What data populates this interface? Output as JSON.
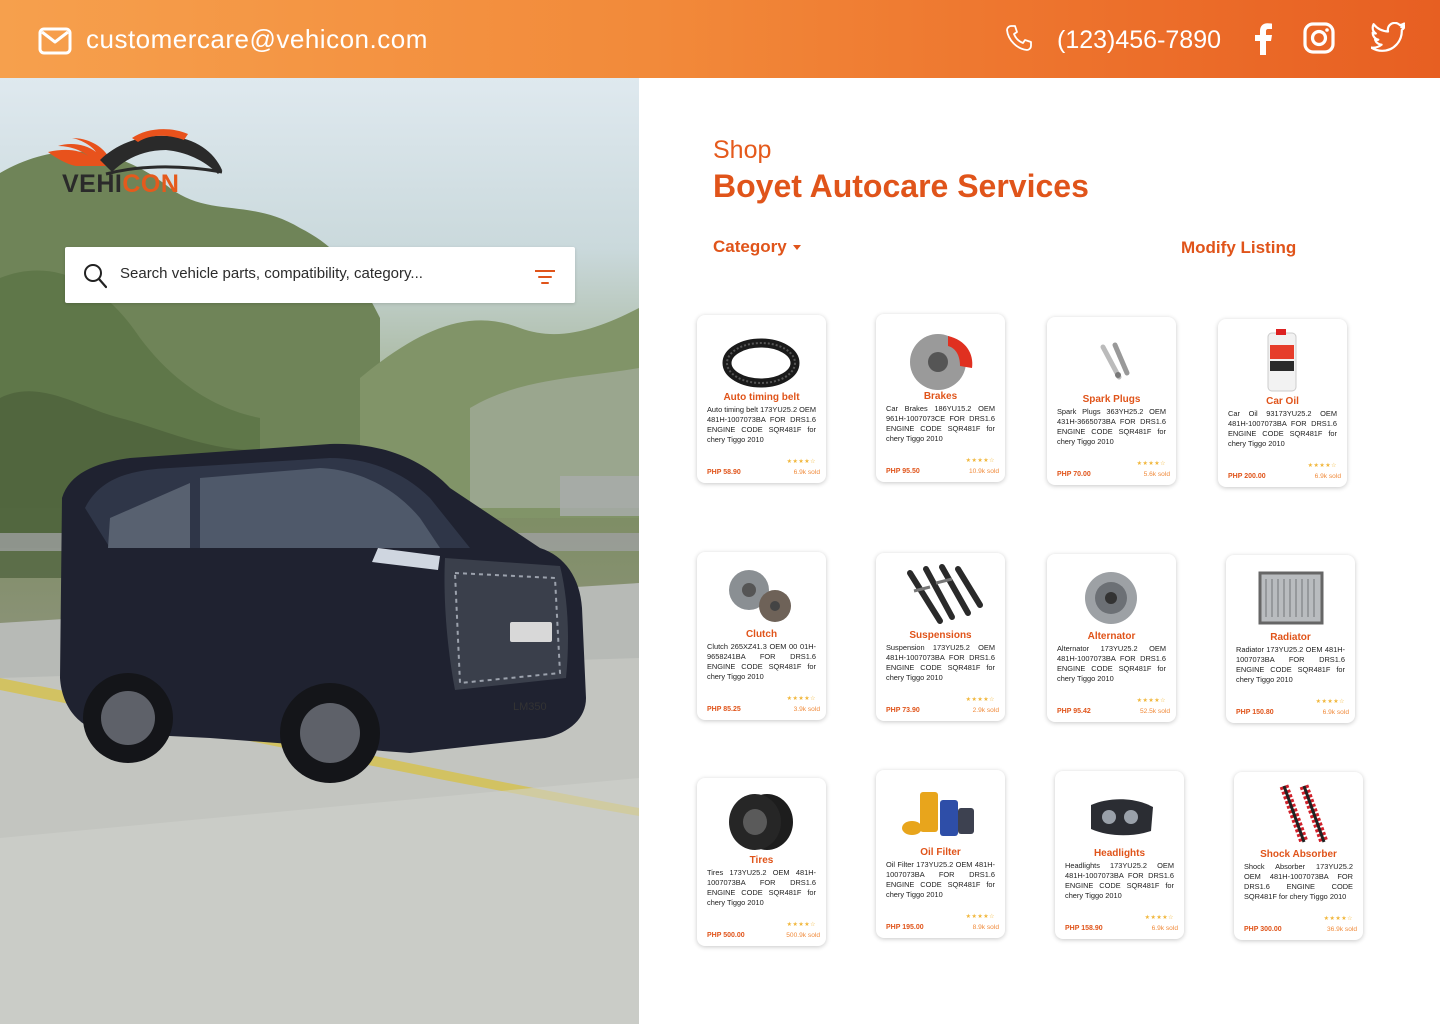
{
  "header": {
    "email": "customercare@vehicon.com",
    "phone": "(123)456-7890"
  },
  "brand": {
    "name_left": "VEHI",
    "name_right": "CON"
  },
  "search": {
    "placeholder": "Search vehicle parts, compatibility, category..."
  },
  "hero": {
    "plate": "LM350"
  },
  "shop": {
    "label": "Shop",
    "name": "Boyet Autocare Services",
    "category_label": "Category",
    "modify_label": "Modify Listing"
  },
  "products": [
    {
      "title": "Auto timing belt",
      "desc": "Auto timing belt 173YU25.2 OEM 481H-1007073BA FOR DRS1.6 ENGINE CODE SQR481F for chery Tiggo 2010",
      "price": "PHP 58.90",
      "sold": "6.9k sold",
      "stars": "★★★★☆"
    },
    {
      "title": "Brakes",
      "desc": "Car Brakes 186YU15.2 OEM 961H-1007073CE FOR DRS1.6 ENGINE CODE SQR481F for chery Tiggo 2010",
      "price": "PHP 95.50",
      "sold": "10.9k sold",
      "stars": "★★★★☆"
    },
    {
      "title": "Spark Plugs",
      "desc": "Spark Plugs 363YH25.2 OEM 431H-3665073BA FOR DRS1.6 ENGINE CODE SQR481F for chery Tiggo 2010",
      "price": "PHP 70.00",
      "sold": "5.6k sold",
      "stars": "★★★★☆"
    },
    {
      "title": "Car Oil",
      "desc": "Car Oil 93173YU25.2 OEM 481H-1007073BA FOR DRS1.6 ENGINE CODE SQR481F for chery Tiggo 2010",
      "price": "PHP 200.00",
      "sold": "6.9k sold",
      "stars": "★★★★☆"
    },
    {
      "title": "Clutch",
      "desc": "Clutch 265XZ41.3 OEM 00 01H-9658241BA FOR DRS1.6 ENGINE CODE SQR481F for chery Tiggo 2010",
      "price": "PHP 85.25",
      "sold": "3.9k sold",
      "stars": "★★★★☆"
    },
    {
      "title": "Suspensions",
      "desc": "Suspension 173YU25.2 OEM 481H-1007073BA FOR DRS1.6 ENGINE CODE SQR481F for chery Tiggo 2010",
      "price": "PHP 73.90",
      "sold": "2.9k sold",
      "stars": "★★★★☆"
    },
    {
      "title": "Alternator",
      "desc": "Alternator 173YU25.2 OEM 481H-1007073BA FOR DRS1.6 ENGINE CODE SQR481F for chery Tiggo 2010",
      "price": "PHP 95.42",
      "sold": "52.5k sold",
      "stars": "★★★★☆"
    },
    {
      "title": "Radiator",
      "desc": "Radiator 173YU25.2 OEM 481H-1007073BA FOR DRS1.6 ENGINE CODE SQR481F for chery Tiggo 2010",
      "price": "PHP 150.80",
      "sold": "6.9k sold",
      "stars": "★★★★☆"
    },
    {
      "title": "Tires",
      "desc": "Tires 173YU25.2 OEM 481H-1007073BA FOR DRS1.6 ENGINE CODE SQR481F for chery Tiggo 2010",
      "price": "PHP 500.00",
      "sold": "500.9k sold",
      "stars": "★★★★☆"
    },
    {
      "title": "Oil Filter",
      "desc": "Oil Filter 173YU25.2 OEM 481H-1007073BA FOR DRS1.6 ENGINE CODE SQR481F for chery Tiggo 2010",
      "price": "PHP 195.00",
      "sold": "8.9k sold",
      "stars": "★★★★☆"
    },
    {
      "title": "Headlights",
      "desc": "Headlights 173YU25.2 OEM 481H-1007073BA FOR DRS1.6 ENGINE CODE SQR481F for chery Tiggo 2010",
      "price": "PHP 158.90",
      "sold": "6.9k sold",
      "stars": "★★★★☆"
    },
    {
      "title": "Shock Absorber",
      "desc": "Shock Absorber 173YU25.2 OEM 481H-1007073BA FOR DRS1.6 ENGINE CODE SQR481F for chery Tiggo 2010",
      "price": "PHP 300.00",
      "sold": "36.9k sold",
      "stars": "★★★★☆"
    }
  ],
  "colors": {
    "accent": "#e0541a",
    "topbar_start": "#f6a04d",
    "topbar_end": "#e75f22"
  }
}
